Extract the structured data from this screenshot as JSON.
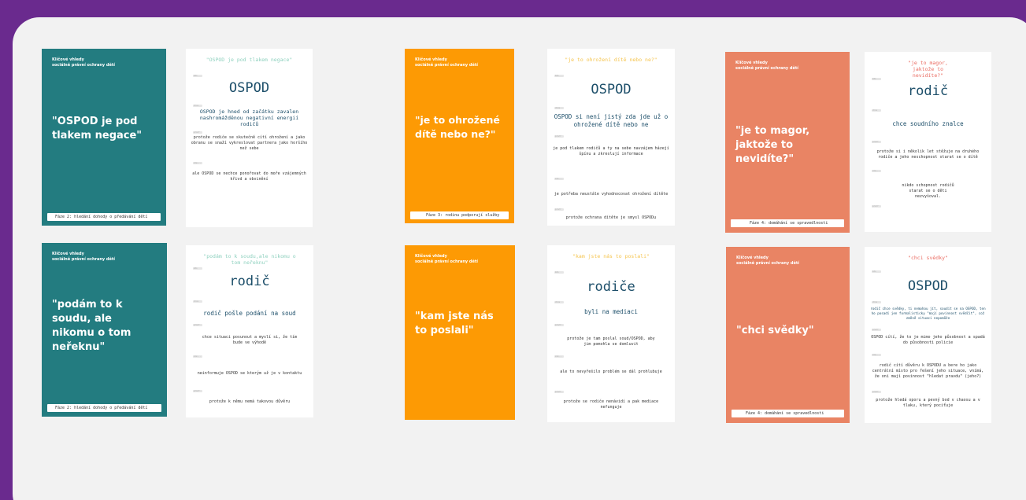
{
  "brand": "Klíčové vhledy\nsociálně právní ochrany dětí",
  "labels": {
    "who": "kdo",
    "wants": "chce",
    "why": "proč?",
    "but": "ale...",
    "why2": "proč?"
  },
  "cards": [
    {
      "cover_quote": "\"OSPOD je pod tlakem negace\"",
      "phase": "Fáze 2: hledání dohody o předávání dětí",
      "detail_quote": "\"OSPOD je pod tlakem negace\"",
      "who": "OSPOD",
      "wants": "OSPOD je hned od začátku zavalen nashromážděnou negativní energií rodičů",
      "why": "protože rodiče se skutečně cítí ohrožení a jako obranu se snaží vykreslovat partnera jako horšího než sebe",
      "but": "ale OSPOD se nechce ponořovat do moře vzájemných křivd a obvinění",
      "why2": ""
    },
    {
      "cover_quote": "\"je to ohrožené dítě nebo ne?\"",
      "phase": "Fáze 3: rodinu podporují služby",
      "detail_quote": "\"je to ohrožení dítě nebo ne?\"",
      "who": "OSPOD",
      "wants": "OSPOD si není jistý zda jde už o ohrožené dítě nebo ne",
      "why": "je pod tlakem rodičů a ty na sebe navzájem házejí špínu a zkreslují informace",
      "but": "je potřeba neustále vyhodnocovat ohrožení dítěte",
      "why2": "protože ochrana dítěte je smysl OSPODu"
    },
    {
      "cover_quote": "\"je to magor, jaktože to nevidíte?\"",
      "phase": "Fáze 4: domáhání se spravedlnosti",
      "detail_quote": "\"je to magor, jaktože to nevidíte?\"",
      "who": "rodič",
      "wants": "chce soudního znalce",
      "why": "protože si i několik let stěžuje na druhého rodiče a jeho neschopnost starat se o dítě",
      "but": "nikdo schopnost rodičů starat se o děti nezvyšoval.",
      "why2": ""
    },
    {
      "cover_quote": "\"podám to k soudu, ale nikomu o tom neřeknu\"",
      "phase": "Fáze 2: hledání dohody o předávání dětí",
      "detail_quote": "\"podám to k soudu,ale nikomu o tom neřeknu\"",
      "who": "rodič",
      "wants": "rodič pošle podání na soud",
      "why": "chce situaci posunout a myslí si, že tím bude ve výhodě",
      "but": "neinformuje OSPOD se kterým už je v kontaktu",
      "why2": "protože k němu nemá takovou důvěru"
    },
    {
      "cover_quote": "\"kam jste nás to poslali\"",
      "phase": "",
      "detail_quote": "\"kam jste nás to poslali\"",
      "who": "rodiče",
      "wants": "byli na mediaci",
      "why": "protože je tam poslal soud/OSPOD, aby jim pomohla se domluvit",
      "but": "ale to nevyřešilo problém se dál prohlubuje",
      "why2": "protože se rodiče nenávidí a pak mediace nefunguje"
    },
    {
      "cover_quote": "\"chci svědky\"",
      "phase": "Fáze 4: domáhání se spravedlnosti",
      "detail_quote": "\"chci svědky\"",
      "who": "OSPOD",
      "wants": "rodič chce svědky, ti nemohou jít, soudit se na OSPOD, ten ho posadí jen formalisticky \"mají povinnost svědčit\", což změně situaci nepomůže",
      "why": "OSPOD cítí, že to je mimo jeho působnost a spadá do působnosti policie",
      "but": "rodič cítí důvěru k OSPODU a bere ho jako centrální místo pro řešení jeho situace, vnímá, že oni mají povinnost \"hledat pravdu\" (jeho?)",
      "why2": "protože hledá oporu a pevný bod v chaosu a v tlaku, který pociťuje"
    }
  ]
}
